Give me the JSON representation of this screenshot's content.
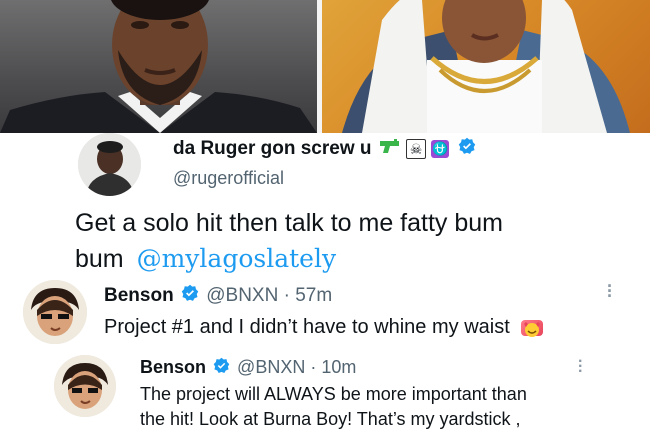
{
  "main_tweet": {
    "display_name": "da Ruger gon screw u",
    "name_icons": [
      "pistol-icon",
      "skull-crossbones-icon",
      "ophiuchus-icon"
    ],
    "handle": "@rugerofficial",
    "text_line1": "Get a solo hit then talk to me fatty bum",
    "text_line2": "bum",
    "mention": "@mylagoslately"
  },
  "reply1": {
    "display_name": "Benson",
    "handle": "@BNXN",
    "time": "· 57m",
    "text": "Project #1 and I didn’t have to whine my waist"
  },
  "reply2": {
    "display_name": "Benson",
    "handle": "@BNXN",
    "time": "· 10m",
    "text_line1": "The project will ALWAYS be more important than",
    "text_line2": "the hit! Look at Burna Boy! That’s my yardstick ,"
  },
  "colors": {
    "accent": "#1d9bf0",
    "secondary_text": "#536471"
  }
}
